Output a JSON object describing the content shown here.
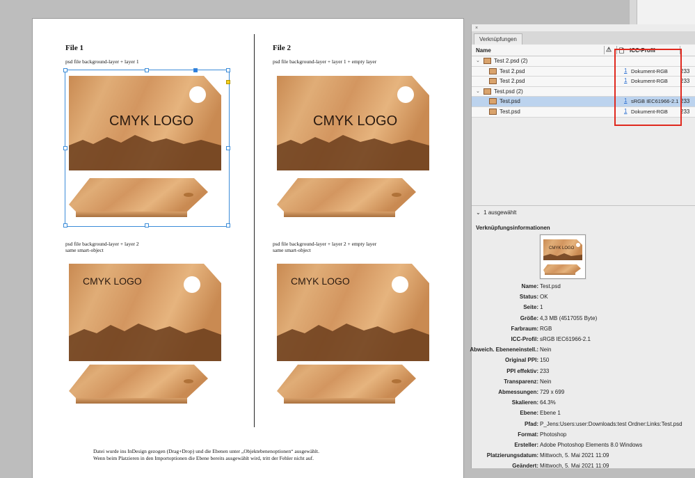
{
  "document": {
    "file1": {
      "title": "File 1",
      "caption1": "psd file background-layer + layer 1",
      "caption2a": "psd file background-layer + layer 2",
      "caption2b": "same smart-object"
    },
    "file2": {
      "title": "File 2",
      "caption1": "psd file background-layer + layer 1 + empty layer",
      "caption2a": "psd file background-layer + layer 2 + empty layer",
      "caption2b": "same smart-object"
    },
    "logo_text": "CMYK LOGO",
    "footnote_line1": "Datei wurde ins InDesign gezogen (Drag+Drop) und die Ebenen unter „Objektebenenoptionen“ ausgewählt.",
    "footnote_line2": "Wenn beim Platzieren in den Importoptionen die Ebene bereits ausgewählt wird, tritt der Fehler nicht auf."
  },
  "panel": {
    "close_symbol": "×",
    "tab_label": "Verknüpfungen",
    "columns": {
      "name": "Name",
      "warning_symbol": "⚠",
      "doc_symbol": "🗋",
      "icc": "ICC-Profil"
    },
    "links": [
      {
        "type": "group",
        "label": "Test 2.psd (2)"
      },
      {
        "type": "item",
        "label": "Test 2.psd",
        "page": "1",
        "icc": "Dokument-RGB",
        "ppi": "233",
        "selected": false
      },
      {
        "type": "item",
        "label": "Test 2.psd",
        "page": "1",
        "icc": "Dokument-RGB",
        "ppi": "233",
        "selected": false
      },
      {
        "type": "group",
        "label": "Test.psd (2)"
      },
      {
        "type": "item",
        "label": "Test.psd",
        "page": "1",
        "icc": "sRGB IEC61966-2.1",
        "ppi": "233",
        "selected": true
      },
      {
        "type": "item",
        "label": "Test.psd",
        "page": "1",
        "icc": "Dokument-RGB",
        "ppi": "233",
        "selected": false
      }
    ],
    "selection_count": "1 ausgewählt",
    "info_header": "Verknüpfungsinformationen",
    "info": [
      {
        "key": "Name:",
        "value": "Test.psd"
      },
      {
        "key": "Status:",
        "value": "OK"
      },
      {
        "key": "Seite:",
        "value": "1"
      },
      {
        "key": "Größe:",
        "value": "4,3 MB (4517055 Byte)"
      },
      {
        "key": "Farbraum:",
        "value": "RGB"
      },
      {
        "key": "ICC-Profil:",
        "value": "sRGB IEC61966-2.1"
      },
      {
        "key": "Abweich. Ebeneneinstell.:",
        "value": "Nein"
      },
      {
        "key": "Original PPI:",
        "value": "150"
      },
      {
        "key": "PPI effektiv:",
        "value": "233"
      },
      {
        "key": "Transparenz:",
        "value": "Nein"
      },
      {
        "key": "Abmessungen:",
        "value": "729 x 699"
      },
      {
        "key": "Skalieren:",
        "value": "64.3%"
      },
      {
        "key": "Ebene:",
        "value": "Ebene 1"
      },
      {
        "key": "Pfad:",
        "value": "P_Jens:Users:user:Downloads:test Ordner:Links:Test.psd"
      },
      {
        "key": "Format:",
        "value": "Photoshop"
      },
      {
        "key": "Ersteller:",
        "value": "Adobe Photoshop Elements 8.0 Windows"
      },
      {
        "key": "Platzierungsdatum:",
        "value": "Mittwoch, 5. Mai 2021 11:09"
      },
      {
        "key": "Geändert:",
        "value": "Mittwoch, 5. Mai 2021 11:09"
      }
    ],
    "colors": {
      "highlight_box": "#e0281d",
      "selected_row": "#bcd3ee",
      "link_blue": "#2b6fd1"
    }
  }
}
